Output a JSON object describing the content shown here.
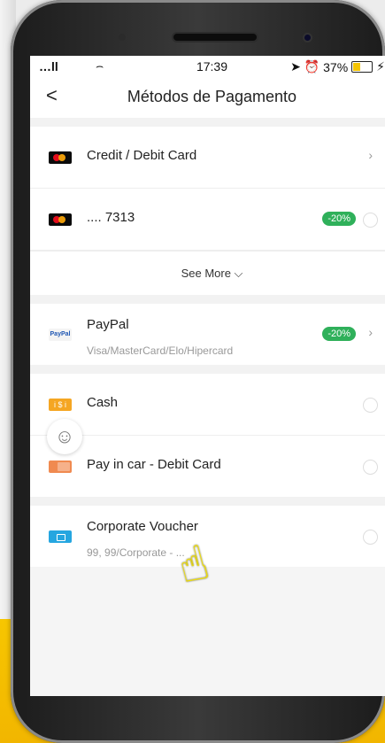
{
  "status_bar": {
    "signal": "…ll",
    "wifi": "⌢",
    "time": "17:39",
    "right_icons": "➤ ⏰",
    "battery": "37%",
    "charging": "⚡"
  },
  "nav": {
    "back": "<",
    "title": "Métodos de Pagamento"
  },
  "cards": {
    "items": [
      {
        "label": "Credit / Debit Card",
        "right": "chevron"
      },
      {
        "label": ".... 7313",
        "badge": "-20%",
        "right": "radio"
      }
    ],
    "see_more": "See More ⌵"
  },
  "paypal": {
    "label": "PayPal",
    "sub": "Visa/MasterCard/Elo/Hipercard",
    "badge": "-20%",
    "icon_text": "PayPal"
  },
  "cash": {
    "label": "Cash",
    "icon_text": "i $ i"
  },
  "pay_in_car": {
    "label": "Pay in car - Debit Card"
  },
  "voucher": {
    "label": "Corporate Voucher",
    "sub": "99, 99/Corporate - ..."
  },
  "colors": {
    "badge": "#2fb05a",
    "yellow": "#f7c600"
  },
  "icons": {
    "smiley": "☺",
    "hand": "☝"
  }
}
